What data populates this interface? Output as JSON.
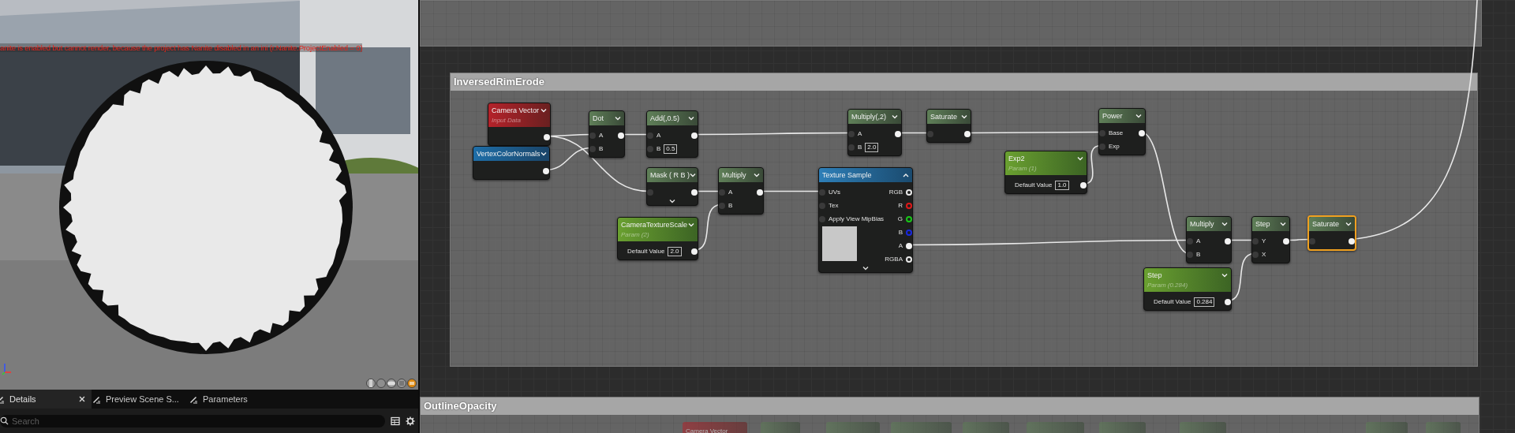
{
  "viewport": {
    "message": "anite is enabled but cannot render, because the project has Nanite disabled in an ini (r.Nanite.ProjectEnabled = 0)"
  },
  "panel_tabs": [
    {
      "label": "Details",
      "selected": true,
      "closable": true
    },
    {
      "label": "Preview Scene S...",
      "selected": false,
      "closable": false
    },
    {
      "label": "Parameters",
      "selected": false,
      "closable": false
    }
  ],
  "search": {
    "placeholder": "Search"
  },
  "graph": {
    "comments": [
      {
        "kind": "blank"
      },
      {
        "kind": "titled",
        "title": "InversedRimErode"
      },
      {
        "kind": "titled",
        "title": "OutlineOpacity"
      }
    ],
    "nodes": [
      {
        "title": "Camera Vector",
        "subtitle": "Input Data",
        "kind": "input",
        "selected": false,
        "has_more": false,
        "rows": [
          {
            "has_input": false,
            "has_output": true
          }
        ]
      },
      {
        "title": "VertexColorNormals",
        "kind": "call",
        "selected": false,
        "has_more": false,
        "rows": [
          {
            "has_input": false,
            "has_output": true
          }
        ]
      },
      {
        "title": "Dot",
        "kind": "math",
        "selected": false,
        "has_more": false,
        "rows": [
          {
            "has_input": true,
            "input_label": "A",
            "has_output": true
          },
          {
            "has_input": true,
            "input_label": "B",
            "has_output": false
          }
        ]
      },
      {
        "title": "Add(,0.5)",
        "kind": "math",
        "selected": false,
        "has_more": false,
        "rows": [
          {
            "has_input": true,
            "input_label": "A",
            "has_output": true
          },
          {
            "has_input": true,
            "input_label": "B",
            "value": "0.5",
            "has_output": false
          }
        ]
      },
      {
        "title": "Mask ( R B )",
        "kind": "math",
        "selected": false,
        "has_more": true,
        "rows": [
          {
            "has_input": true,
            "has_output": true
          }
        ]
      },
      {
        "title": "Multiply",
        "kind": "math",
        "selected": false,
        "has_more": false,
        "rows": [
          {
            "has_input": true,
            "input_label": "A",
            "has_output": true
          },
          {
            "has_input": true,
            "input_label": "B",
            "has_output": false
          }
        ]
      },
      {
        "title": "CameraTextureScale",
        "subtitle": "Param (2)",
        "kind": "param",
        "selected": false,
        "has_more": false,
        "rows": [
          {
            "has_input": false,
            "input_label": "Default Value",
            "value": "2.0",
            "has_output": true
          }
        ]
      },
      {
        "title": "Multiply(,2)",
        "kind": "math",
        "selected": false,
        "has_more": false,
        "rows": [
          {
            "has_input": true,
            "input_label": "A",
            "has_output": true
          },
          {
            "has_input": true,
            "input_label": "B",
            "value": "2.0",
            "has_output": false
          }
        ]
      },
      {
        "title": "Texture Sample",
        "kind": "texture",
        "selected": false,
        "has_more": true,
        "rows": [
          {
            "has_input": true,
            "input_label": "UVs",
            "has_output": true,
            "output_label": "RGB"
          },
          {
            "has_input": true,
            "input_label": "Tex",
            "has_output": true,
            "output_label": "R",
            "color": "#e01818"
          },
          {
            "has_input": true,
            "input_label": "Apply View MipBias",
            "has_output": true,
            "output_label": "G",
            "color": "#18c818"
          },
          {
            "has_input": false,
            "has_output": true,
            "output_label": "B",
            "color": "#1828e0"
          },
          {
            "has_input": false,
            "has_output": true,
            "output_label": "A"
          },
          {
            "has_input": false,
            "has_output": true,
            "output_label": "RGBA"
          }
        ]
      },
      {
        "title": "Saturate",
        "kind": "math",
        "selected": false,
        "has_more": false,
        "rows": [
          {
            "has_input": true,
            "has_output": true
          }
        ]
      },
      {
        "title": "Power",
        "kind": "math",
        "selected": false,
        "has_more": false,
        "rows": [
          {
            "has_input": true,
            "input_label": "Base",
            "has_output": true
          },
          {
            "has_input": true,
            "input_label": "Exp",
            "has_output": false
          }
        ]
      },
      {
        "title": "Exp2",
        "subtitle": "Param (1)",
        "kind": "param",
        "selected": false,
        "has_more": false,
        "rows": [
          {
            "has_input": false,
            "input_label": "Default Value",
            "value": "1.0",
            "has_output": true
          }
        ]
      },
      {
        "title": "Multiply",
        "kind": "math",
        "selected": false,
        "has_more": false,
        "rows": [
          {
            "has_input": true,
            "input_label": "A",
            "has_output": true
          },
          {
            "has_input": true,
            "input_label": "B",
            "has_output": false
          }
        ]
      },
      {
        "title": "Step",
        "kind": "math",
        "selected": false,
        "has_more": false,
        "rows": [
          {
            "has_input": true,
            "input_label": "Y",
            "has_output": true
          },
          {
            "has_input": true,
            "input_label": "X",
            "has_output": false
          }
        ]
      },
      {
        "title": "Saturate",
        "kind": "math",
        "selected": true,
        "has_more": false,
        "rows": [
          {
            "has_input": true,
            "has_output": true
          }
        ]
      },
      {
        "title": "Step",
        "subtitle": "Param (0.284)",
        "kind": "param",
        "selected": false,
        "has_more": false,
        "rows": [
          {
            "has_input": false,
            "input_label": "Default Value",
            "value": "0.284",
            "has_output": true
          }
        ]
      }
    ],
    "partial_nodes": [
      {
        "kind": "input",
        "title": "Camera Vector"
      },
      {
        "kind": "math"
      },
      {
        "kind": "math"
      },
      {
        "kind": "math"
      },
      {
        "kind": "math"
      },
      {
        "kind": "math"
      },
      {
        "kind": "math"
      },
      {
        "kind": "math"
      },
      {
        "kind": "math"
      },
      {
        "kind": "math"
      }
    ]
  }
}
